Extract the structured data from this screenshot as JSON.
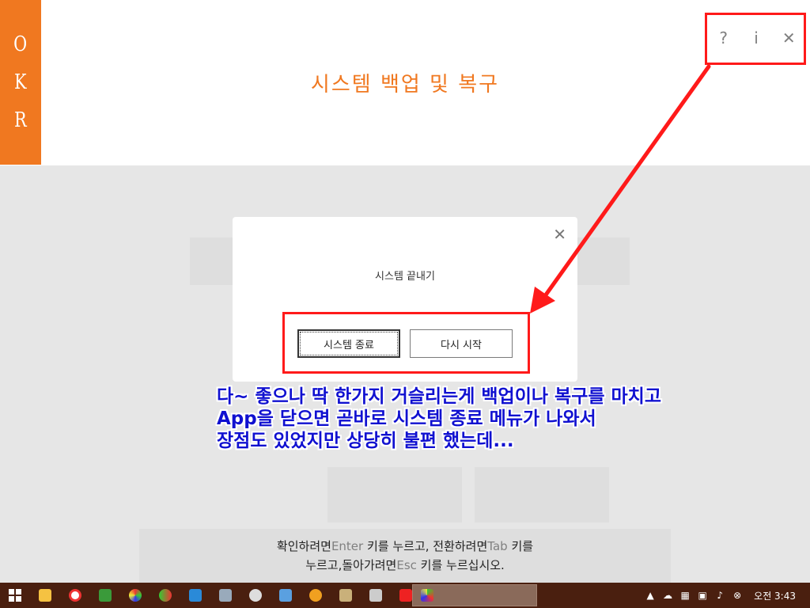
{
  "header": {
    "logo_letters": [
      "O",
      "K",
      "R"
    ],
    "title": "시스템 백업 및 복구",
    "controls": {
      "help": "?",
      "info": "i",
      "close": "✕"
    }
  },
  "dialog": {
    "close": "✕",
    "title": "시스템 끝내기",
    "shutdown_button": "시스템 종료",
    "restart_button": "다시 시작"
  },
  "annotation": {
    "lines": [
      "다~ 좋으나 딱 한가지 거슬리는게  백업이나 복구를 마치고",
      "App을 닫으면 곧바로 시스템 종료 메뉴가 나와서",
      "장점도 있었지만 상당히 불편 했는데..."
    ],
    "color": "#1010d0",
    "highlight_color": "#ff1a1a"
  },
  "hint": {
    "line1_a": "확인하려면",
    "line1_key1": "Enter",
    "line1_b": " 키를 누르고, 전환하려면",
    "line1_key2": "Tab",
    "line1_c": " 키를",
    "line2_a": "누르고,돌아가려면",
    "line2_key": "Esc",
    "line2_b": " 키를 누르십시오."
  },
  "taskbar": {
    "clock": "오전 3:43",
    "pinned_icons": [
      "windows-start-icon",
      "file-explorer-icon",
      "lifebuoy-icon",
      "puzzle-icon",
      "colorwheel-icon",
      "paint-icon",
      "butterfly-icon",
      "hardware-icon",
      "bird-icon",
      "window-manager-icon",
      "orange-circle-icon",
      "jar-icon",
      "tools-icon",
      "red-x-icon"
    ],
    "active_app_icon": "backup-app-icon",
    "tray_icons": [
      "flag-icon",
      "cloud-icon",
      "network-icon",
      "display-icon",
      "volume-icon",
      "close-circle-icon"
    ]
  },
  "colors": {
    "accent": "#f07820",
    "taskbar": "#4a1f0f"
  }
}
